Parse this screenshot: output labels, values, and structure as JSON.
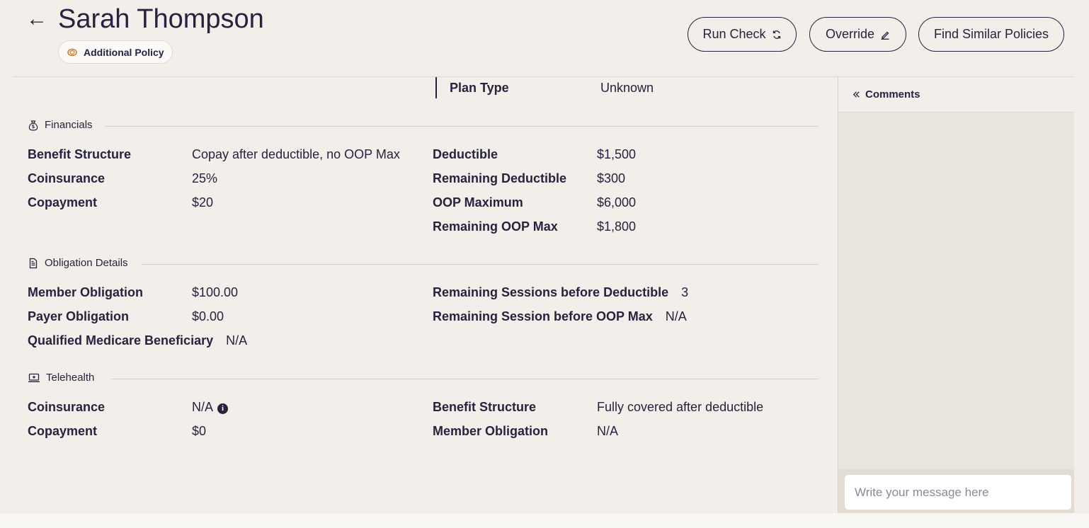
{
  "header": {
    "back_icon": "←",
    "name": "Sarah Thompson",
    "badge_label": "Additional Policy",
    "buttons": {
      "run_check": "Run Check",
      "override": "Override",
      "find_similar": "Find Similar Policies"
    }
  },
  "plan_type": {
    "label": "Plan Type",
    "value": "Unknown"
  },
  "financials": {
    "title": "Financials",
    "left": [
      {
        "label": "Benefit Structure",
        "value": "Copay after deductible, no OOP Max"
      },
      {
        "label": "Coinsurance",
        "value": "25%"
      },
      {
        "label": "Copayment",
        "value": "$20"
      }
    ],
    "right": [
      {
        "label": "Deductible",
        "value": "$1,500"
      },
      {
        "label": "Remaining Deductible",
        "value": "$300"
      },
      {
        "label": "OOP Maximum",
        "value": "$6,000"
      },
      {
        "label": "Remaining OOP Max",
        "value": "$1,800"
      }
    ]
  },
  "obligation": {
    "title": "Obligation Details",
    "left": [
      {
        "label": "Member Obligation",
        "value": "$100.00"
      },
      {
        "label": "Payer Obligation",
        "value": "$0.00"
      },
      {
        "label": "Qualified Medicare Beneficiary",
        "value": "N/A"
      }
    ],
    "right": [
      {
        "label": "Remaining Sessions before Deductible",
        "value": "3"
      },
      {
        "label": "Remaining Session before OOP Max",
        "value": "N/A"
      }
    ]
  },
  "telehealth": {
    "title": "Telehealth",
    "left": [
      {
        "label": "Coinsurance",
        "value": "N/A"
      },
      {
        "label": "Copayment",
        "value": "$0"
      }
    ],
    "right": [
      {
        "label": "Benefit Structure",
        "value": "Fully covered after deductible"
      },
      {
        "label": "Member Obligation",
        "value": "N/A"
      }
    ]
  },
  "comments": {
    "title": "Comments",
    "placeholder": "Write your message here"
  },
  "colors": {
    "ink": "#26223f",
    "background": "#f2efea",
    "badge_accent": "#c77a2e"
  }
}
